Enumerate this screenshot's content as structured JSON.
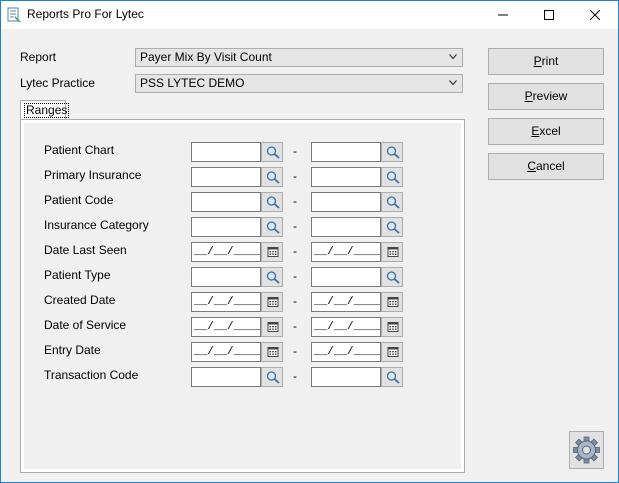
{
  "window": {
    "title": "Reports Pro For Lytec"
  },
  "report": {
    "label": "Report",
    "value": "Payer Mix By Visit Count"
  },
  "practice": {
    "label": "Lytec Practice",
    "value": "PSS LYTEC DEMO"
  },
  "tab": {
    "label": "Ranges"
  },
  "ranges": [
    {
      "label": "Patient Chart",
      "kind": "lookup",
      "from": "",
      "to": ""
    },
    {
      "label": "Primary Insurance",
      "kind": "lookup",
      "from": "",
      "to": ""
    },
    {
      "label": "Patient Code",
      "kind": "lookup",
      "from": "",
      "to": ""
    },
    {
      "label": "Insurance Category",
      "kind": "lookup",
      "from": "",
      "to": ""
    },
    {
      "label": "Date Last Seen",
      "kind": "date",
      "from": "__/__/____",
      "to": "__/__/____"
    },
    {
      "label": "Patient Type",
      "kind": "lookup",
      "from": "",
      "to": ""
    },
    {
      "label": "Created Date",
      "kind": "date",
      "from": "__/__/____",
      "to": "__/__/____"
    },
    {
      "label": "Date of Service",
      "kind": "date",
      "from": "__/__/____",
      "to": "__/__/____"
    },
    {
      "label": "Entry Date",
      "kind": "date",
      "from": "__/__/____",
      "to": "__/__/____"
    },
    {
      "label": "Transaction Code",
      "kind": "lookup",
      "from": "",
      "to": ""
    }
  ],
  "separator": "-",
  "buttons": {
    "print": {
      "first": "P",
      "rest": "rint"
    },
    "preview": {
      "first": "P",
      "rest": "review"
    },
    "excel": {
      "first": "E",
      "rest": "xcel"
    },
    "cancel": {
      "first": "C",
      "rest": "ancel"
    }
  },
  "icons": {
    "lookup": "magnifier-icon",
    "date": "calendar-icon",
    "settings": "gear-icon"
  }
}
